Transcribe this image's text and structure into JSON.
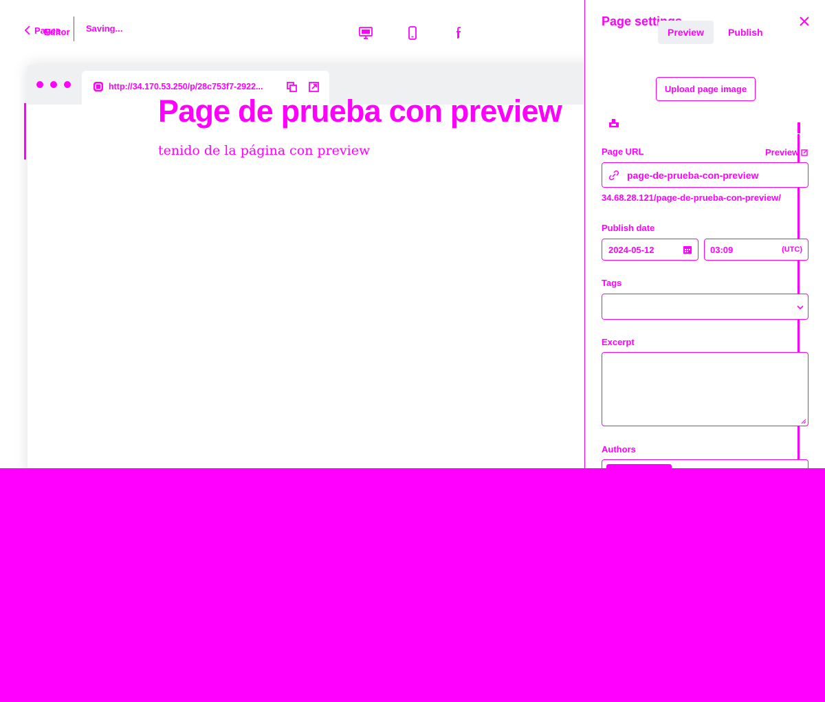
{
  "toolbar": {
    "back_label": "Pages",
    "overlap_label": "Editor",
    "status": "Saving...",
    "devices": [
      {
        "name": "desktop",
        "icon": "desktop-icon"
      },
      {
        "name": "mobile",
        "icon": "mobile-icon"
      },
      {
        "name": "facebook",
        "icon": "facebook-icon"
      }
    ],
    "tabs": [
      "Preview",
      "Publish"
    ]
  },
  "preview": {
    "url": "http://34.170.53.250/p/28c753f7-2922...",
    "title": "Page de prueba con preview",
    "excerpt": "tenido de la página con preview"
  },
  "settings": {
    "title": "Page settings",
    "upload_label": "Upload page image",
    "page_url_label": "Page URL",
    "preview_link": "Preview",
    "slug": "page-de-prueba-con-preview",
    "full_url": "34.68.28.121/page-de-prueba-con-preview/",
    "publish_date_label": "Publish date",
    "date": "2024-05-12",
    "time": "03:09",
    "timezone": "(UTC)",
    "tags_label": "Tags",
    "tags_value": "",
    "excerpt_label": "Excerpt",
    "excerpt_value": "",
    "authors_label": "Authors"
  },
  "colors": {
    "accent": "#ff00ff",
    "tab_active_bg": "#eeeff2",
    "frame_bar": "#eff0f2",
    "background": "#ffffff"
  }
}
